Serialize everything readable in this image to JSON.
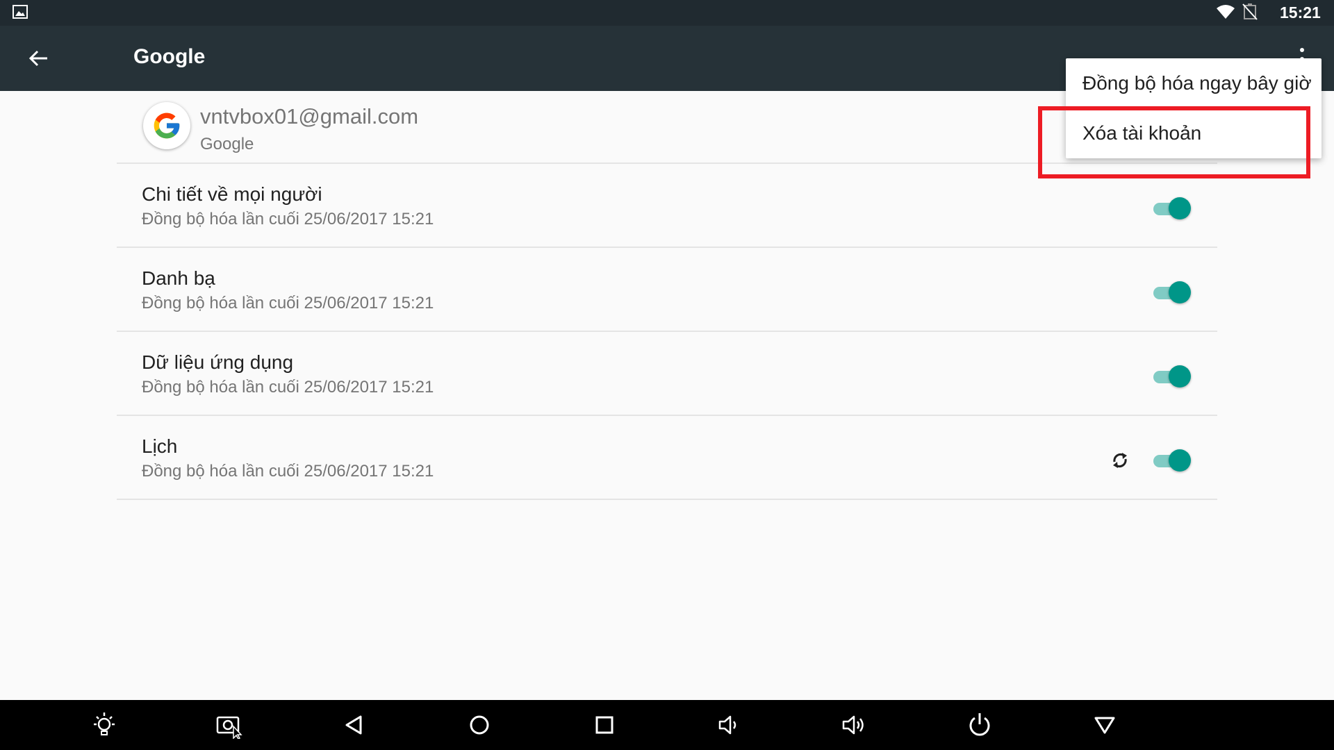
{
  "status_bar": {
    "clock": "15:21",
    "icons": [
      "image-notification-icon",
      "wifi-icon",
      "no-battery-icon"
    ]
  },
  "app_bar": {
    "title": "Google",
    "icons": [
      "back-arrow-icon",
      "overflow-menu-icon"
    ]
  },
  "account": {
    "email": "vntvbox01@gmail.com",
    "type": "Google",
    "icon": "google-logo-icon"
  },
  "sync_items": [
    {
      "title": "Chi tiết về mọi người",
      "subtitle": "Đồng bộ hóa lần cuối 25/06/2017 15:21",
      "enabled": true
    },
    {
      "title": "Danh bạ",
      "subtitle": "Đồng bộ hóa lần cuối 25/06/2017 15:21",
      "enabled": true
    },
    {
      "title": "Dữ liệu ứng dụng",
      "subtitle": "Đồng bộ hóa lần cuối 25/06/2017 15:21",
      "enabled": true
    },
    {
      "title": "Lịch",
      "subtitle": "Đồng bộ hóa lần cuối 25/06/2017 15:21",
      "enabled": true,
      "syncing": true
    }
  ],
  "menu": {
    "items": [
      "Đồng bộ hóa ngay bây giờ",
      "Xóa tài khoản"
    ],
    "highlighted_index": 1,
    "highlight_color": "#ed1c24"
  },
  "nav_bar": {
    "icons": [
      "brightness-icon",
      "screenshot-icon",
      "back-icon",
      "home-icon",
      "recents-icon",
      "volume-down-icon",
      "volume-up-icon",
      "power-icon",
      "hide-bar-icon"
    ]
  },
  "colors": {
    "status_bar": "#202a30",
    "app_bar": "#263238",
    "accent": "#009688",
    "accent_track": "#80cbc4",
    "background": "#fafafa"
  }
}
